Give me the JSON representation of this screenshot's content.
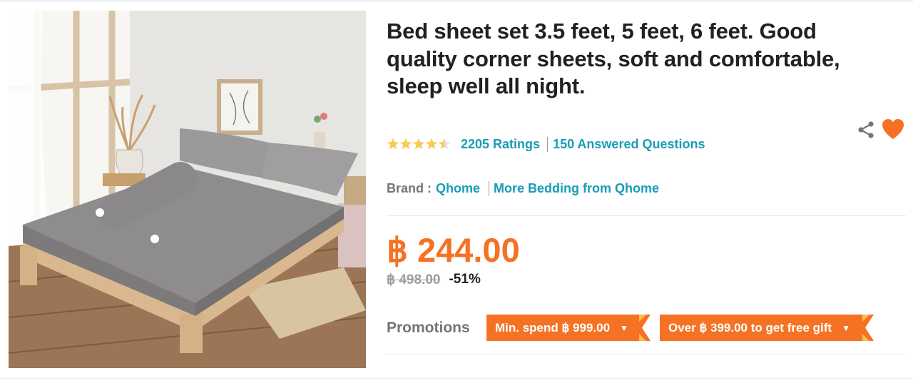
{
  "product": {
    "title": "Bed sheet set 3.5 feet, 5 feet, 6 feet. Good quality corner sheets, soft and comfortable, sleep well all night.",
    "image_alt": "Grey fitted bed sheet set on wooden bed frame with pillows and bolsters"
  },
  "rating": {
    "stars": 4.5,
    "ratings_text": "2205 Ratings",
    "questions_text": "150 Answered Questions"
  },
  "brand": {
    "label": "Brand :",
    "name": "Qhome",
    "more_link": "More Bedding from Qhome"
  },
  "price": {
    "current": "฿ 244.00",
    "original": "฿ 498.00",
    "discount": "-51%"
  },
  "promotions": {
    "label": "Promotions",
    "items": [
      {
        "text": "Min. spend ฿ 999.00"
      },
      {
        "text": "Over ฿ 399.00 to get free gift"
      }
    ]
  },
  "icons": {
    "share": "share-icon",
    "wishlist": "heart-icon",
    "dropdown": "caret-down-icon"
  },
  "colors": {
    "accent": "#f57224",
    "link": "#1a9cb7",
    "star": "#faca51",
    "text": "#212121",
    "muted": "#757575"
  }
}
